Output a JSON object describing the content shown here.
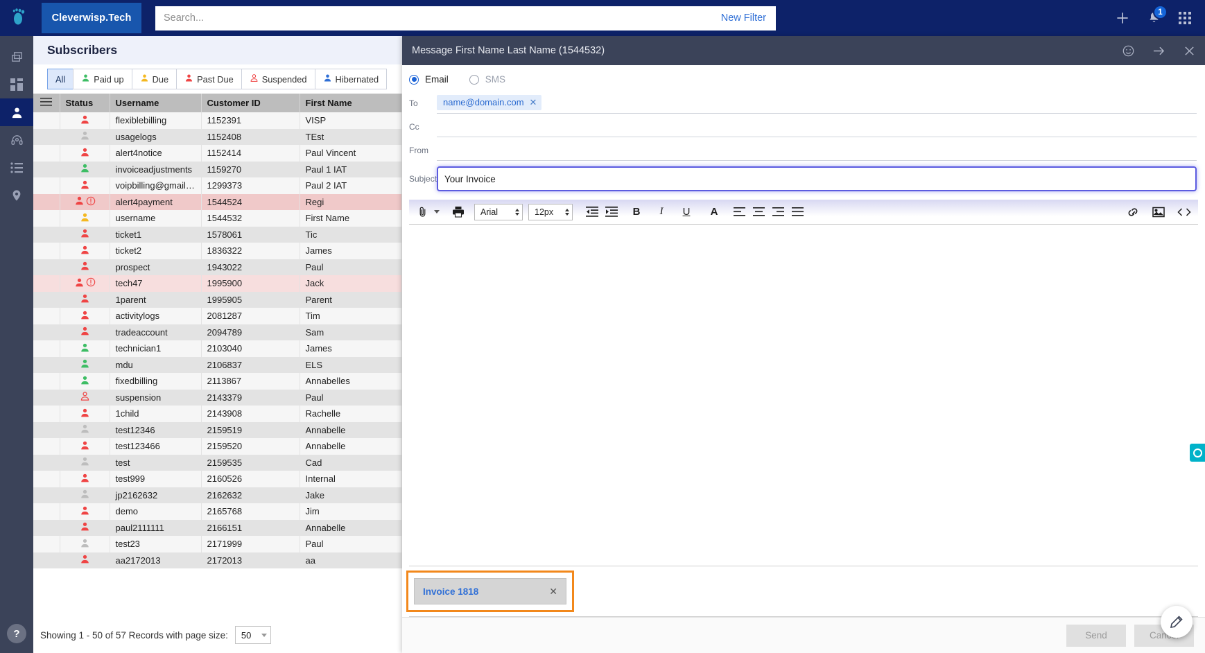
{
  "topbar": {
    "logo_icon": "footprint-logo-icon",
    "brand": "Cleverwisp.Tech",
    "search_placeholder": "Search...",
    "search_value": "",
    "new_filter_label": "New Filter",
    "add_icon": "plus-icon",
    "notifications_icon": "bell-icon",
    "notifications_count": "1",
    "apps_icon": "grid-apps-icon"
  },
  "rail": {
    "items": [
      {
        "name": "sidebar-item-copy",
        "icon": "layers-copy-icon",
        "active": false
      },
      {
        "name": "sidebar-item-dashboard",
        "icon": "dashboard-grid-icon",
        "active": false
      },
      {
        "name": "sidebar-item-subscribers",
        "icon": "person-icon",
        "active": true
      },
      {
        "name": "sidebar-item-support",
        "icon": "headset-icon",
        "active": false
      },
      {
        "name": "sidebar-item-list",
        "icon": "list-icon",
        "active": false
      },
      {
        "name": "sidebar-item-map",
        "icon": "location-pin-icon",
        "active": false
      }
    ],
    "help_label": "?"
  },
  "subscribers": {
    "title": "Subscribers",
    "tabs": [
      {
        "label": "All",
        "icon": "none",
        "active": true
      },
      {
        "label": "Paid up",
        "icon": "person-green-icon",
        "active": false
      },
      {
        "label": "Due",
        "icon": "person-yellow-icon",
        "active": false
      },
      {
        "label": "Past Due",
        "icon": "person-red-icon",
        "active": false
      },
      {
        "label": "Suspended",
        "icon": "person-outline-red-icon",
        "active": false
      },
      {
        "label": "Hibernated",
        "icon": "person-blue-icon",
        "active": false
      }
    ],
    "columns": [
      "",
      "Status",
      "Username",
      "Customer ID",
      "First Name"
    ],
    "menu_icon": "hamburger-menu-icon",
    "rows": [
      {
        "status": "red",
        "alert": false,
        "username": "flexiblebilling",
        "customer_id": "1152391",
        "first_name": "VISP"
      },
      {
        "status": "grey",
        "alert": false,
        "username": "usagelogs",
        "customer_id": "1152408",
        "first_name": "TEst"
      },
      {
        "status": "red",
        "alert": false,
        "username": "alert4notice",
        "customer_id": "1152414",
        "first_name": "Paul Vincent"
      },
      {
        "status": "green",
        "alert": false,
        "username": "invoiceadjustments",
        "customer_id": "1159270",
        "first_name": "Paul 1 IAT"
      },
      {
        "status": "red",
        "alert": false,
        "username": "voipbilling@gmail.co...",
        "customer_id": "1299373",
        "first_name": "Paul 2 IAT"
      },
      {
        "status": "red",
        "alert": true,
        "username": "alert4payment",
        "customer_id": "1544524",
        "first_name": "Regi"
      },
      {
        "status": "yellow",
        "alert": false,
        "username": "username",
        "customer_id": "1544532",
        "first_name": "First Name"
      },
      {
        "status": "red",
        "alert": false,
        "username": "ticket1",
        "customer_id": "1578061",
        "first_name": "Tic"
      },
      {
        "status": "red",
        "alert": false,
        "username": "ticket2",
        "customer_id": "1836322",
        "first_name": "James"
      },
      {
        "status": "red",
        "alert": false,
        "username": "prospect",
        "customer_id": "1943022",
        "first_name": "Paul"
      },
      {
        "status": "red",
        "alert": true,
        "username": "tech47",
        "customer_id": "1995900",
        "first_name": "Jack"
      },
      {
        "status": "red",
        "alert": false,
        "username": "1parent",
        "customer_id": "1995905",
        "first_name": "Parent"
      },
      {
        "status": "red",
        "alert": false,
        "username": "activitylogs",
        "customer_id": "2081287",
        "first_name": "Tim"
      },
      {
        "status": "red",
        "alert": false,
        "username": "tradeaccount",
        "customer_id": "2094789",
        "first_name": "Sam"
      },
      {
        "status": "green",
        "alert": false,
        "username": "technician1",
        "customer_id": "2103040",
        "first_name": "James"
      },
      {
        "status": "green",
        "alert": false,
        "username": "mdu",
        "customer_id": "2106837",
        "first_name": "ELS"
      },
      {
        "status": "green",
        "alert": false,
        "username": "fixedbilling",
        "customer_id": "2113867",
        "first_name": "Annabelles"
      },
      {
        "status": "outline-red",
        "alert": false,
        "username": "suspension",
        "customer_id": "2143379",
        "first_name": "Paul"
      },
      {
        "status": "red",
        "alert": false,
        "username": "1child",
        "customer_id": "2143908",
        "first_name": "Rachelle"
      },
      {
        "status": "grey",
        "alert": false,
        "username": "test12346",
        "customer_id": "2159519",
        "first_name": "Annabelle"
      },
      {
        "status": "red",
        "alert": false,
        "username": "test123466",
        "customer_id": "2159520",
        "first_name": "Annabelle"
      },
      {
        "status": "grey",
        "alert": false,
        "username": "test",
        "customer_id": "2159535",
        "first_name": "Cad"
      },
      {
        "status": "red",
        "alert": false,
        "username": "test999",
        "customer_id": "2160526",
        "first_name": "Internal"
      },
      {
        "status": "grey",
        "alert": false,
        "username": "jp2162632",
        "customer_id": "2162632",
        "first_name": "Jake"
      },
      {
        "status": "red",
        "alert": false,
        "username": "demo",
        "customer_id": "2165768",
        "first_name": "Jim"
      },
      {
        "status": "red",
        "alert": false,
        "username": "paul2111111",
        "customer_id": "2166151",
        "first_name": "Annabelle"
      },
      {
        "status": "grey",
        "alert": false,
        "username": "test23",
        "customer_id": "2171999",
        "first_name": "Paul"
      },
      {
        "status": "red",
        "alert": false,
        "username": "aa2172013",
        "customer_id": "2172013",
        "first_name": "aa"
      }
    ],
    "footer_text": "Showing 1 - 50 of 57 Records with page size:",
    "page_size": "50"
  },
  "message_panel": {
    "title": "Message First Name Last Name (1544532)",
    "header_icons": [
      "emoji-icon",
      "arrow-right-icon",
      "close-icon"
    ],
    "channel": {
      "email_label": "Email",
      "sms_label": "SMS",
      "selected": "Email"
    },
    "to_label": "To",
    "to_chip": "name@domain.com",
    "cc_label": "Cc",
    "cc_value": "",
    "from_label": "From",
    "from_value": "",
    "subject_label": "Subject",
    "subject_value": "Your Invoice",
    "toolbar": {
      "attach_icon": "paperclip-icon",
      "print_icon": "printer-icon",
      "font_family": "Arial",
      "font_size": "12px",
      "outdent_icon": "outdent-icon",
      "indent_icon": "indent-icon",
      "bold_label": "B",
      "italic_label": "I",
      "underline_label": "U",
      "text_color_label": "A",
      "align_left_icon": "align-left-icon",
      "align_center_icon": "align-center-icon",
      "align_right_icon": "align-right-icon",
      "align_justify_icon": "align-justify-icon",
      "link_icon": "link-icon",
      "image_icon": "image-icon",
      "code_icon": "code-icon"
    },
    "body_value": "",
    "attachment": {
      "label": "Invoice 1818",
      "remove_label": "×"
    },
    "send_label": "Send",
    "cancel_label": "Cancel"
  },
  "widgets": {
    "chat_icon": "chat-bubble-icon",
    "fab_icon": "edit-pen-icon"
  }
}
